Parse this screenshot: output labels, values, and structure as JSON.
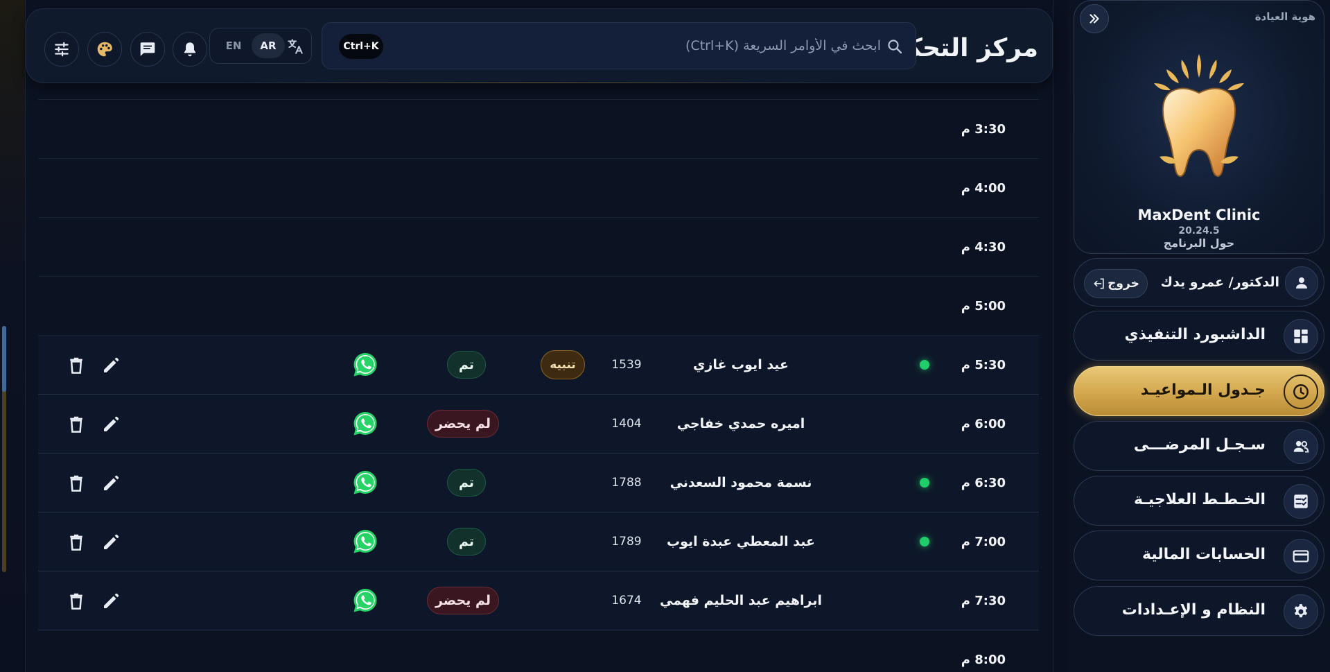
{
  "header": {
    "title": "مركز التحكم",
    "search_placeholder": "ابحث في الأوامر السريعة (Ctrl+K)",
    "shortcut": "Ctrl+K",
    "lang_ar": "AR",
    "lang_en": "EN"
  },
  "schedule": {
    "empty_slots": [
      {
        "time": "3:30 م"
      },
      {
        "time": "4:00 م"
      },
      {
        "time": "4:30 م"
      },
      {
        "time": "5:00 م"
      }
    ],
    "appointments": [
      {
        "time": "5:30 م",
        "online": true,
        "name": "عيد ايوب غازي",
        "code": "1539",
        "alert": "تنبيه",
        "status": "تم",
        "status_type": "done"
      },
      {
        "time": "6:00 م",
        "online": false,
        "name": "اميره حمدي خفاجي",
        "code": "1404",
        "alert": "",
        "status": "لم يحضر",
        "status_type": "absent"
      },
      {
        "time": "6:30 م",
        "online": true,
        "name": "نسمة محمود السعدني",
        "code": "1788",
        "alert": "",
        "status": "تم",
        "status_type": "done"
      },
      {
        "time": "7:00 م",
        "online": true,
        "name": "عبد المعطي عبدة ايوب",
        "code": "1789",
        "alert": "",
        "status": "تم",
        "status_type": "done"
      },
      {
        "time": "7:30 م",
        "online": false,
        "name": "ابراهيم عبد الحليم فهمي",
        "code": "1674",
        "alert": "",
        "status": "لم يحضر",
        "status_type": "absent"
      }
    ],
    "trailing_slot": {
      "time": "8:00 م"
    }
  },
  "sidebar": {
    "brand_label": "هوية العيادة",
    "clinic_name": "MaxDent Clinic",
    "version": "20.24.5",
    "about": "حول البرنامج",
    "user_name": "الدكتور/ عمرو يدك",
    "logout": "خروج",
    "nav": [
      {
        "label": "الداشبورد التنفيذي",
        "icon": "dashboard-icon"
      },
      {
        "label": "جـدول الـمواعيـد",
        "icon": "clock-icon",
        "active": true
      },
      {
        "label": "سـجـل المرضـــى",
        "icon": "patients-icon"
      },
      {
        "label": "الخـطـط العلاجيـة",
        "icon": "checklist-icon"
      },
      {
        "label": "الحسابات المالية",
        "icon": "card-icon"
      },
      {
        "label": "النظام و الإعـدادات",
        "icon": "gear-icon"
      }
    ]
  },
  "colors": {
    "gold": "#d3a74e",
    "online": "#1fce6b",
    "whatsapp": "#25d366",
    "background": "#0b1222"
  }
}
